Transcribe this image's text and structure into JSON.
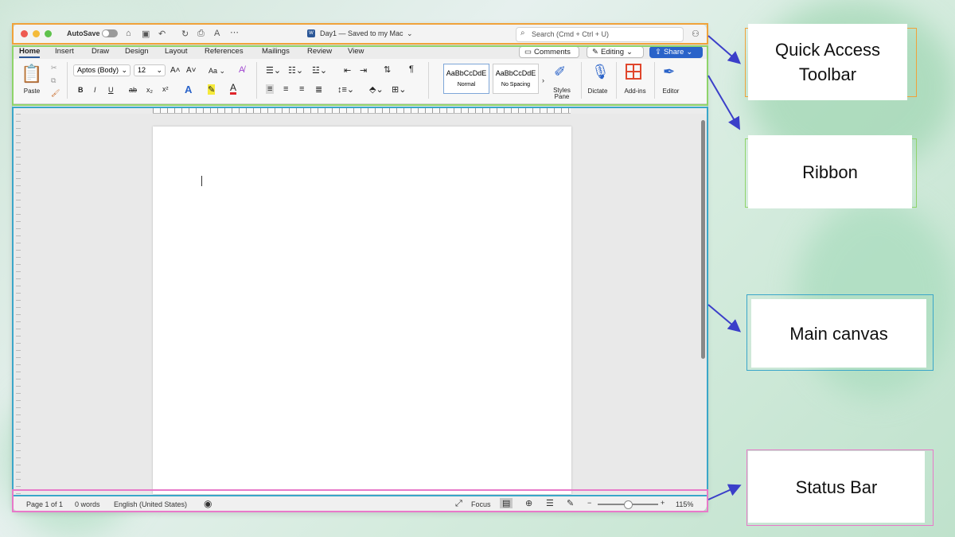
{
  "window": {
    "autosave_label": "AutoSave",
    "doc_title": "Day1 — Saved to my Mac",
    "search_placeholder": "Search (Cmd + Ctrl + U)"
  },
  "tabs": [
    "Home",
    "Insert",
    "Draw",
    "Design",
    "Layout",
    "References",
    "Mailings",
    "Review",
    "View"
  ],
  "header_buttons": {
    "comments": "Comments",
    "editing": "Editing",
    "share": "Share"
  },
  "ribbon": {
    "paste": "Paste",
    "font_name": "Aptos (Body)",
    "font_size": "12",
    "change_case": "Aa",
    "styles": [
      {
        "preview": "AaBbCcDdE",
        "name": "Normal"
      },
      {
        "preview": "AaBbCcDdE",
        "name": "No Spacing"
      }
    ],
    "styles_pane": "Styles Pane",
    "dictate": "Dictate",
    "addins": "Add-ins",
    "editor": "Editor",
    "bold": "B",
    "italic": "I",
    "underline": "U",
    "strike": "ab",
    "subscript": "x₂",
    "superscript": "x²",
    "font_grow": "A˄",
    "font_shrink": "A˅",
    "text_effects": "A",
    "font_color": "A"
  },
  "status": {
    "page": "Page 1 of 1",
    "words": "0 words",
    "language": "English (United States)",
    "focus": "Focus",
    "zoom": "115%"
  },
  "annotations": {
    "qat": "Quick Access Toolbar",
    "ribbon": "Ribbon",
    "canvas": "Main canvas",
    "status": "Status Bar"
  },
  "colors": {
    "qat": "#f0a23a",
    "ribbon": "#8fd46a",
    "canvas": "#3aa6c9",
    "status": "#e879c9",
    "arrow": "#3b3fc9"
  }
}
